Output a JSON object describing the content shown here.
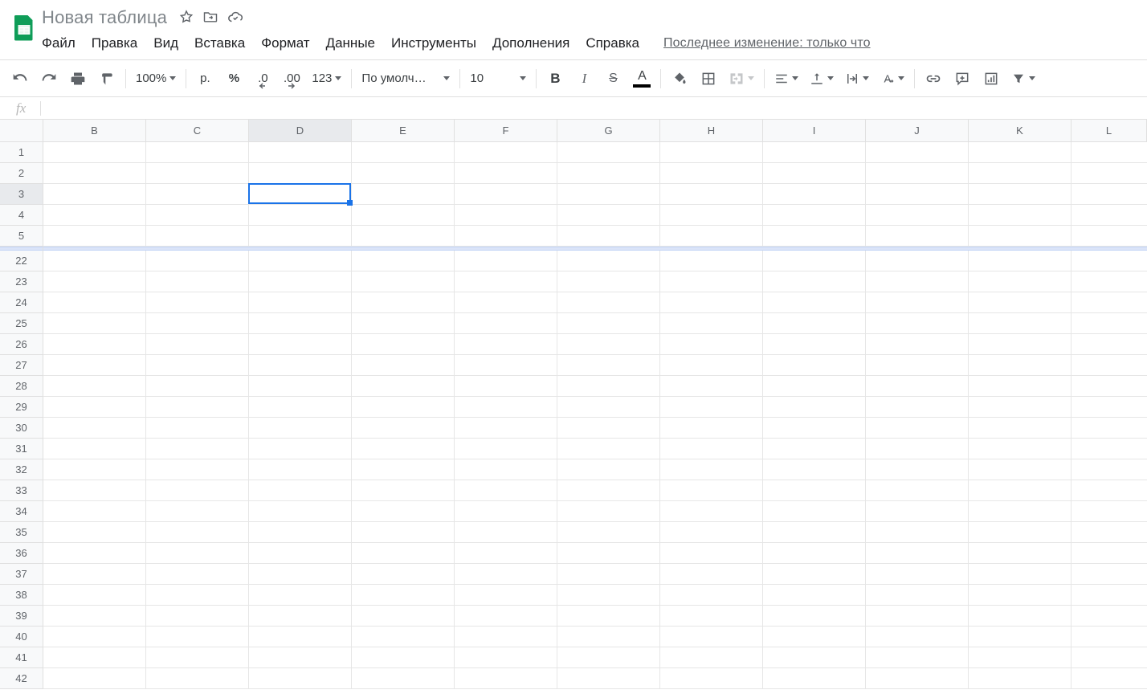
{
  "header": {
    "title": "Новая таблица",
    "last_change": "Последнее изменение: только что"
  },
  "menu": {
    "file": "Файл",
    "edit": "Правка",
    "view": "Вид",
    "insert": "Вставка",
    "format": "Формат",
    "data": "Данные",
    "tools": "Инструменты",
    "addons": "Дополнения",
    "help": "Справка"
  },
  "toolbar": {
    "zoom": "100%",
    "currency_label": "р.",
    "percent_label": "%",
    "dec_decrease": ".0",
    "dec_increase": ".00",
    "num_format": "123",
    "font": "По умолча...",
    "font_size": "10"
  },
  "formula_bar": {
    "fx": "fx",
    "value": ""
  },
  "grid": {
    "columns": [
      "B",
      "C",
      "D",
      "E",
      "F",
      "G",
      "H",
      "I",
      "J",
      "K",
      "L"
    ],
    "rows_top": [
      "1",
      "2",
      "3",
      "4",
      "5"
    ],
    "rows_bottom": [
      "22",
      "23",
      "24",
      "25",
      "26",
      "27",
      "28",
      "29",
      "30",
      "31",
      "32",
      "33",
      "34",
      "35",
      "36",
      "37",
      "38",
      "39",
      "40",
      "41",
      "42"
    ],
    "selected_column": "D",
    "selected_row": "3",
    "active_cell": "D3"
  },
  "colors": {
    "accent": "#1a73e8",
    "app_green": "#0f9d58"
  }
}
